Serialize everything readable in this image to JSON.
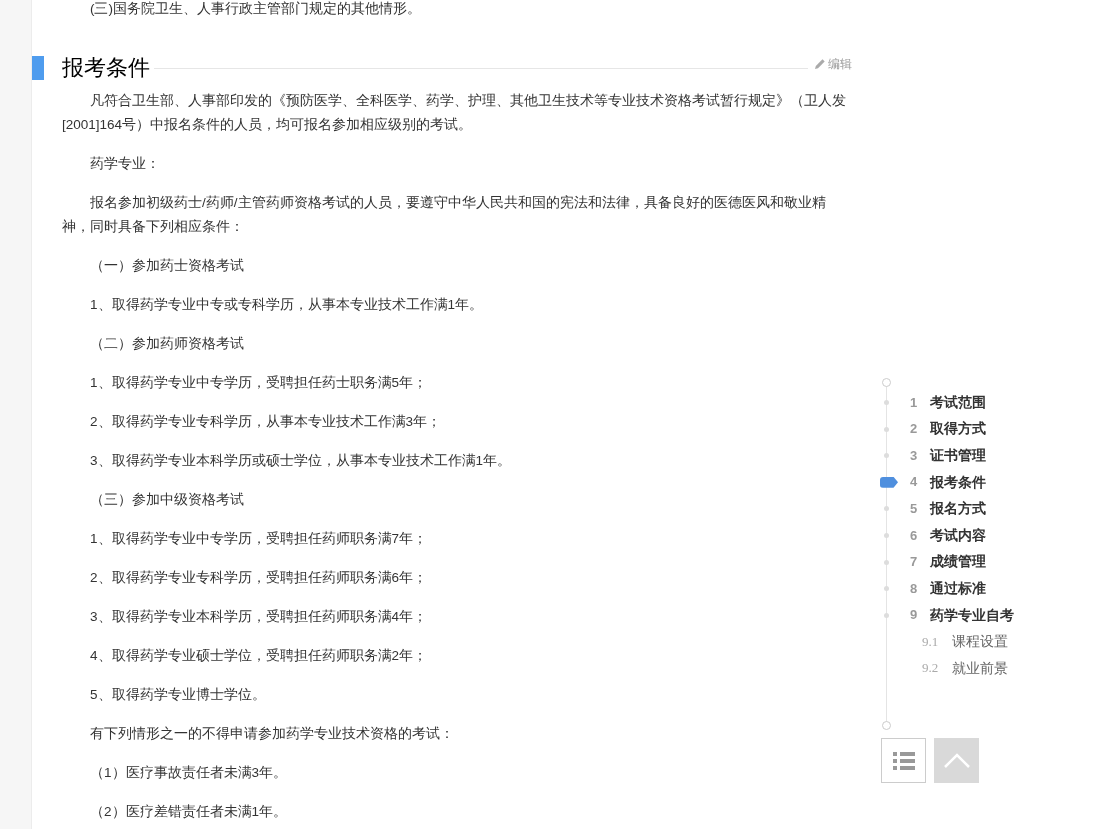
{
  "previous_paragraph": "(三)国务院卫生、人事行政主管部门规定的其他情形。",
  "section": {
    "title": "报考条件",
    "edit_label": "编辑"
  },
  "paragraphs": [
    "凡符合卫生部、人事部印发的《预防医学、全科医学、药学、护理、其他卫生技术等专业技术资格考试暂行规定》（卫人发[2001]164号）中报名条件的人员，均可报名参加相应级别的考试。",
    "药学专业：",
    "报名参加初级药士/药师/主管药师资格考试的人员，要遵守中华人民共和国的宪法和法律，具备良好的医德医风和敬业精神，同时具备下列相应条件：",
    "（一）参加药士资格考试",
    "1、取得药学专业中专或专科学历，从事本专业技术工作满1年。",
    "（二）参加药师资格考试",
    "1、取得药学专业中专学历，受聘担任药士职务满5年；",
    "2、取得药学专业专科学历，从事本专业技术工作满3年；",
    "3、取得药学专业本科学历或硕士学位，从事本专业技术工作满1年。",
    "（三）参加中级资格考试",
    "1、取得药学专业中专学历，受聘担任药师职务满7年；",
    "2、取得药学专业专科学历，受聘担任药师职务满6年；",
    "3、取得药学专业本科学历，受聘担任药师职务满4年；",
    "4、取得药学专业硕士学位，受聘担任药师职务满2年；",
    "5、取得药学专业博士学位。",
    "有下列情形之一的不得申请参加药学专业技术资格的考试：",
    "（1）医疗事故责任者未满3年。",
    "（2）医疗差错责任者未满1年。"
  ],
  "toc": [
    {
      "number": "1",
      "label": "考试范围",
      "selected": false
    },
    {
      "number": "2",
      "label": "取得方式",
      "selected": false
    },
    {
      "number": "3",
      "label": "证书管理",
      "selected": false
    },
    {
      "number": "4",
      "label": "报考条件",
      "selected": true
    },
    {
      "number": "5",
      "label": "报名方式",
      "selected": false
    },
    {
      "number": "6",
      "label": "考试内容",
      "selected": false
    },
    {
      "number": "7",
      "label": "成绩管理",
      "selected": false
    },
    {
      "number": "8",
      "label": "通过标准",
      "selected": false
    },
    {
      "number": "9",
      "label": "药学专业自考",
      "selected": false,
      "children": [
        {
          "number": "9.1",
          "label": "课程设置",
          "selected": false
        },
        {
          "number": "9.2",
          "label": "就业前景",
          "selected": false
        }
      ]
    }
  ]
}
